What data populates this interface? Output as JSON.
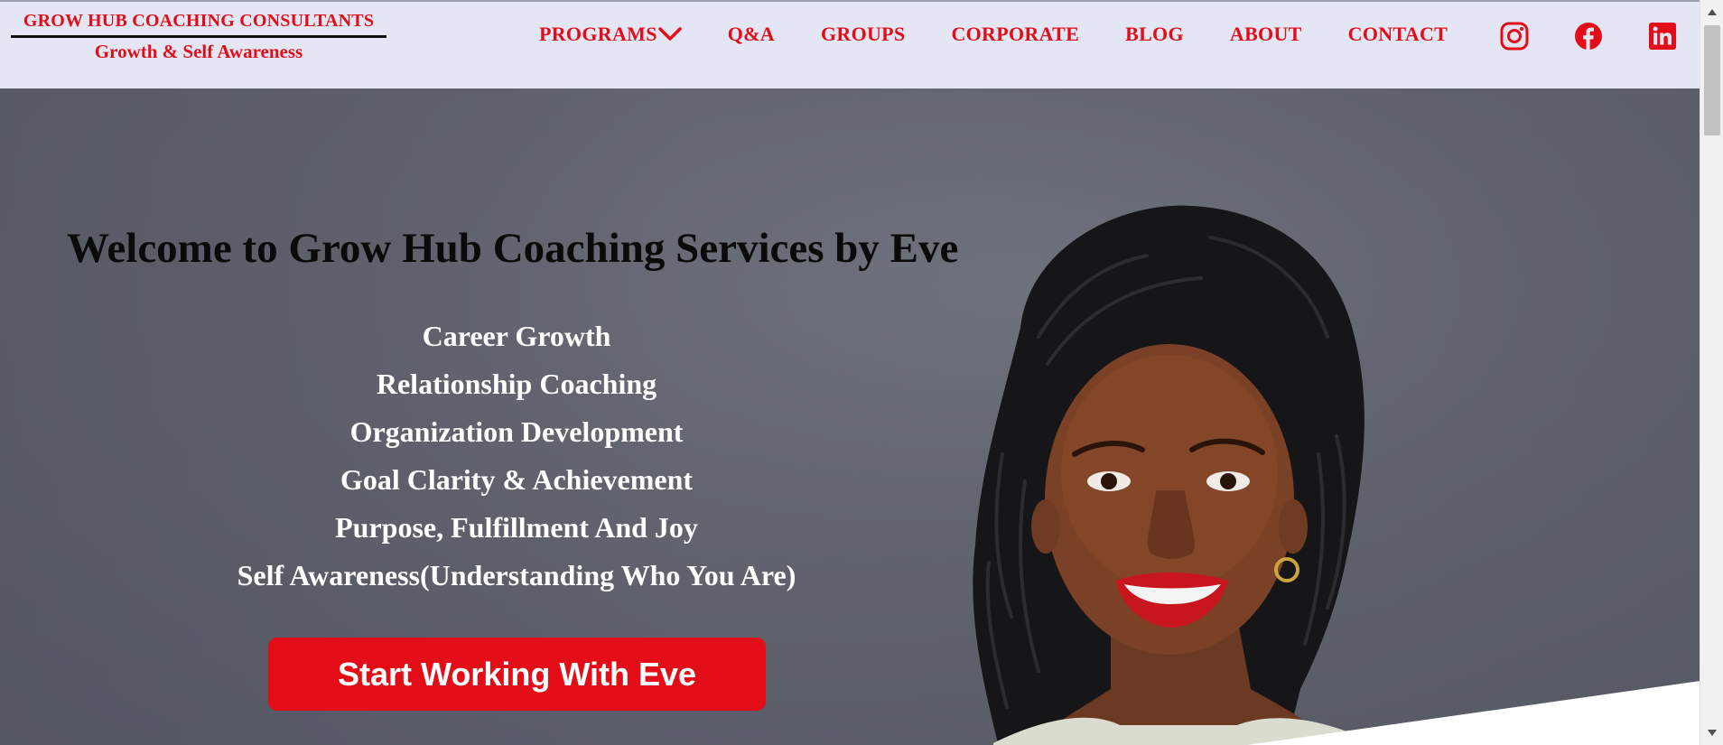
{
  "brand": {
    "title": "GROW HUB COACHING CONSULTANTS",
    "tagline": "Growth & Self Awareness",
    "color": "#e30d1a"
  },
  "nav": {
    "items": [
      {
        "label": "PROGRAMS",
        "has_dropdown": true
      },
      {
        "label": "Q&A"
      },
      {
        "label": "GROUPS"
      },
      {
        "label": "CORPORATE"
      },
      {
        "label": "BLOG"
      },
      {
        "label": "ABOUT"
      },
      {
        "label": "CONTACT"
      }
    ],
    "social_icons": [
      "instagram-icon",
      "facebook-icon",
      "linkedin-icon"
    ]
  },
  "hero": {
    "headline": "Welcome to Grow Hub Coaching Services by Eve",
    "services": [
      "Career Growth",
      "Relationship Coaching",
      "Organization Development",
      "Goal Clarity & Achievement",
      "Purpose, Fulfillment And Joy",
      "Self Awareness(Understanding Who You Are)"
    ],
    "cta_label": "Start Working With Eve",
    "cta_color": "#e30d18"
  }
}
